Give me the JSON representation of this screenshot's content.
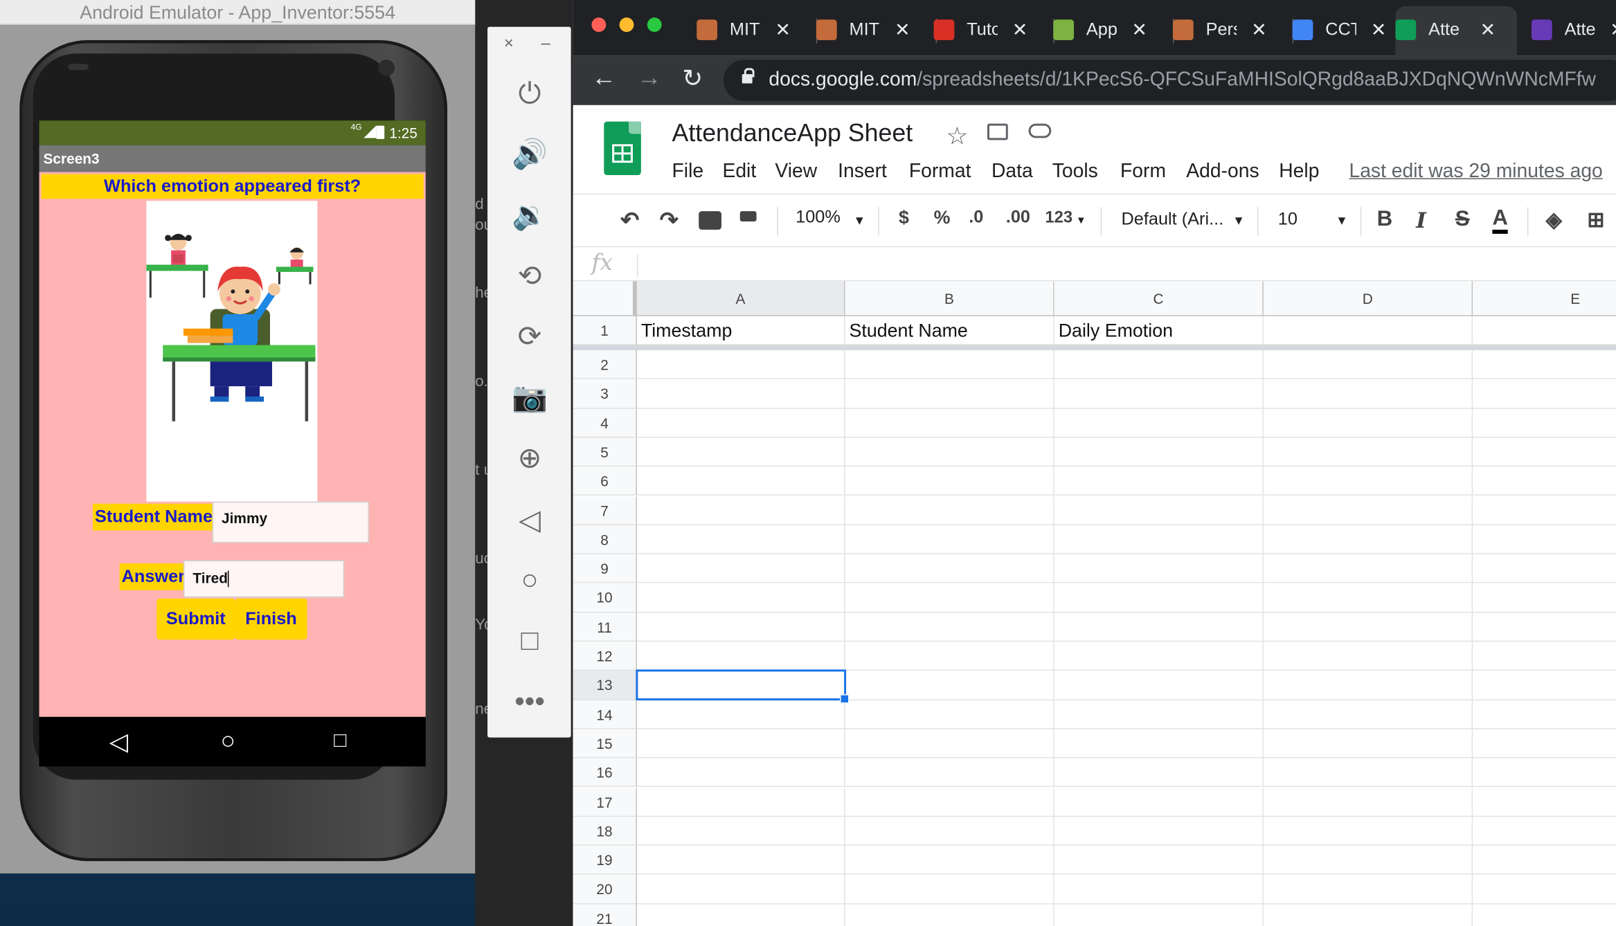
{
  "emulator": {
    "window_title": "Android Emulator - App_Inventor:5554",
    "status": {
      "network": "4G",
      "time": "1:25"
    },
    "screen_title": "Screen3",
    "question": "Which emotion appeared first?",
    "student_name_label": "Student Name",
    "student_name_value": "Jimmy",
    "answer_label": "Answer",
    "answer_value": "Tired",
    "submit_label": "Submit",
    "finish_label": "Finish"
  },
  "emulator_tools": {
    "close": "×",
    "minimize": "–",
    "icons": [
      "power-icon",
      "volume-up-icon",
      "volume-down-icon",
      "rotate-left-icon",
      "rotate-right-icon",
      "camera-icon",
      "zoom-icon",
      "back-icon",
      "home-icon",
      "overview-icon",
      "more-icon"
    ]
  },
  "desktop_fragments": [
    "d",
    "ou",
    "he",
    "o.",
    "t u",
    "uc",
    "Yo",
    "ne"
  ],
  "browser": {
    "tabs": [
      {
        "title": "MIT",
        "color": "#c36b3b"
      },
      {
        "title": "MIT",
        "color": "#c36b3b"
      },
      {
        "title": "Tuto",
        "color": "#d93025"
      },
      {
        "title": "App",
        "color": "#7cb342"
      },
      {
        "title": "Pers",
        "color": "#c36b3b"
      },
      {
        "title": "CCT",
        "color": "#4285f4"
      },
      {
        "title": "Atte",
        "color": "#0f9d58",
        "active": true
      },
      {
        "title": "Atte",
        "color": "#673ab7"
      }
    ],
    "url_domain": "docs.google.com",
    "url_path": "/spreadsheets/d/1KPecS6-QFCSuFaMHISolQRgd8aaBJXDqNQWnWNcMFfw"
  },
  "sheet": {
    "title": "AttendanceApp Sheet",
    "menu": [
      "File",
      "Edit",
      "View",
      "Insert",
      "Format",
      "Data",
      "Tools",
      "Form",
      "Add-ons",
      "Help"
    ],
    "last_edit": "Last edit was 29 minutes ago",
    "toolbar": {
      "zoom": "100%",
      "currency": "$",
      "percent": "%",
      "dec_less": ".0",
      "dec_more": ".00",
      "more_formats": "123",
      "font": "Default (Ari...",
      "font_size": "10",
      "bold": "B",
      "italic": "I",
      "strike": "S",
      "text_color": "A"
    },
    "fx": "fx",
    "columns": [
      "A",
      "B",
      "C",
      "D",
      "E"
    ],
    "rows": [
      "1",
      "2",
      "3",
      "4",
      "5",
      "6",
      "7",
      "8",
      "9",
      "10",
      "11",
      "12",
      "13",
      "14",
      "15",
      "16",
      "17",
      "18",
      "19",
      "20",
      "21"
    ],
    "header_row": [
      "Timestamp",
      "Student Name",
      "Daily Emotion",
      "",
      ""
    ],
    "selected_cell": "A13",
    "accent_color": "#1a73e8"
  }
}
